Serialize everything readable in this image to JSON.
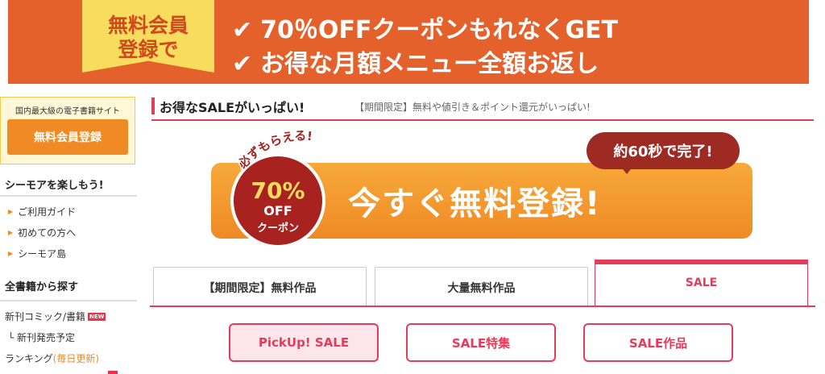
{
  "top_banner": {
    "badge_line1": "無料会員",
    "badge_line2": "登録で",
    "line1": "70％OFFクーポンもれなくGET",
    "line2": "お得な月額メニュー全額お返し",
    "check": "✔"
  },
  "sidebar": {
    "caption": "国内最大級の電子書籍サイト",
    "register_button": "無料会員登録",
    "heading1": "シーモアを楽しもう!",
    "nav": [
      "ご利用ガイド",
      "初めての方へ",
      "シーモア島"
    ],
    "heading2": "全書籍から探す",
    "links": {
      "new_releases": "新刊コミック/書籍",
      "new_badge": "NEW",
      "upcoming": "└ 新刊発売予定",
      "ranking": "ランキング",
      "ranking_note": "(毎日更新)"
    }
  },
  "section": {
    "title": "お得なSALEがいっぱい!",
    "subtitle": "【期間限定】無料や値引き＆ポイント還元がいっぱい!"
  },
  "cta": {
    "arc_text": "必ずもらえる!",
    "coupon_percent": "70%",
    "coupon_off": "OFF",
    "coupon_label": "クーポン",
    "main_text": "今すぐ無料登録!",
    "pill": "約60秒で完了!"
  },
  "tabs": [
    {
      "label": "【期間限定】無料作品"
    },
    {
      "label": "大量無料作品"
    },
    {
      "label": "SALE"
    }
  ],
  "sub_buttons": [
    {
      "label": "PickUp! SALE"
    },
    {
      "label": "SALE特集"
    },
    {
      "label": "SALE作品"
    }
  ],
  "colors": {
    "banner": "#e4612b",
    "badge": "#f8dc5e",
    "accent_pink": "#e63c5c",
    "accent_orange": "#ef8a25",
    "coupon_red": "#a8231f"
  }
}
